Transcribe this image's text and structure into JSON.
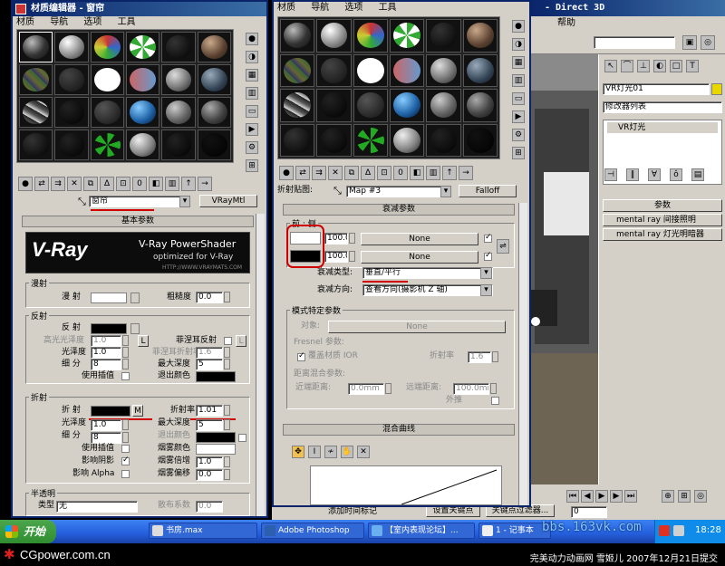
{
  "left_window": {
    "title": "材质编辑器 - 窗帘",
    "menu": [
      "材质",
      "导航",
      "选项",
      "工具"
    ],
    "material_name": "窗帘",
    "material_type": "VRayMtl",
    "rollout_title": "基本参数",
    "logo": {
      "brand": "V-Ray",
      "line1": "V-Ray PowerShader",
      "line2": "optimized for V-Ray",
      "url": "HTTP://WWW.VRAYMATS.COM"
    },
    "diffuse": {
      "group": "漫射",
      "label": "漫 射",
      "roughness_label": "粗糙度",
      "roughness_value": "0.0"
    },
    "reflection": {
      "group": "反射",
      "refl_label": "反 射",
      "hilight_label": "高光光泽度",
      "hilight_value": "1.0",
      "L": "L",
      "fresnel_label": "菲涅耳反射",
      "fresnel_L": "L",
      "gloss_label": "光泽度",
      "gloss_value": "1.0",
      "fresnel_ior_label": "菲涅耳折射率",
      "fresnel_ior_value": "1.6",
      "subdivs_label": "细 分",
      "subdivs_value": "8",
      "maxdepth_label": "最大深度",
      "maxdepth_value": "5",
      "interp_label": "使用插值",
      "exit_label": "退出颜色"
    },
    "refraction": {
      "group": "折射",
      "refr_label": "折 射",
      "M": "M",
      "ior_label": "折射率",
      "ior_value": "1.01",
      "gloss_label": "光泽度",
      "gloss_value": "1.0",
      "maxdepth_label": "最大深度",
      "maxdepth_value": "5",
      "subdivs_label": "细 分",
      "subdivs_value": "8",
      "exit_label": "退出颜色",
      "interp_label": "使用插值",
      "fogcolor_label": "烟雾颜色",
      "shadows_label": "影响阴影",
      "fogmult_label": "烟雾倍增",
      "fogmult_value": "1.0",
      "alpha_label": "影响 Alpha",
      "fogbias_label": "烟雾偏移",
      "fogbias_value": "0.0"
    },
    "translucency": {
      "group": "半透明",
      "type_label": "类型",
      "type_value": "无",
      "scatter_label": "散布系数",
      "scatter_value": "0.0"
    }
  },
  "right_window": {
    "menu": [
      "材质",
      "导航",
      "选项",
      "工具"
    ],
    "map_label": "折射贴图:",
    "map_name": "Map #3",
    "map_type": "Falloff",
    "rollout_falloff": "衰减参数",
    "front_side": "前 : 侧",
    "row1_value": "100.0",
    "row1_map": "None",
    "row2_value": "100.0",
    "row2_map": "None",
    "falloff_type_label": "衰减类型:",
    "falloff_type_value": "垂直/平行",
    "falloff_dir_label": "衰减方向:",
    "falloff_dir_value": "查看方向(摄影机 Z 轴)",
    "mode_group": "模式特定参数",
    "object_label": "对象:",
    "object_value": "None",
    "fresnel_group": "Fresnel 参数:",
    "override_label": "覆盖材质 IOR",
    "ior_label": "折射率",
    "ior_value": "1.6",
    "distance_group": "距离混合参数:",
    "near_label": "近端距离:",
    "near_value": "0.0mm",
    "far_label": "远端距离:",
    "far_value": "100.0mm",
    "extrapolate_label": "外推",
    "rollout_curve": "混合曲线"
  },
  "max_main": {
    "title": "- Direct 3D",
    "menu": [
      "帮助"
    ],
    "light_name": "VR灯光01",
    "modifier_list": "修改器列表",
    "stack_item": "VR灯光",
    "rollouts": [
      "参数",
      "mental ray 间接照明",
      "mental ray 灯光明暗器"
    ],
    "add_time_tag": "添加时间标记",
    "set_key": "设置关键点",
    "key_filter": "关键点过滤器...",
    "frame_value": "0"
  },
  "taskbar": {
    "start": "开始",
    "items": [
      "书房.max",
      "Adobe Photoshop",
      "【室内表现论坛】...",
      "1 - 记事本"
    ],
    "clock": "18:28"
  },
  "overlay": {
    "watermark": "bbs.163vk.com",
    "footer_left": "CGpower.com.cn",
    "footer_right": "完美动力动画网 雪姬儿 2007年12月21日提交"
  }
}
